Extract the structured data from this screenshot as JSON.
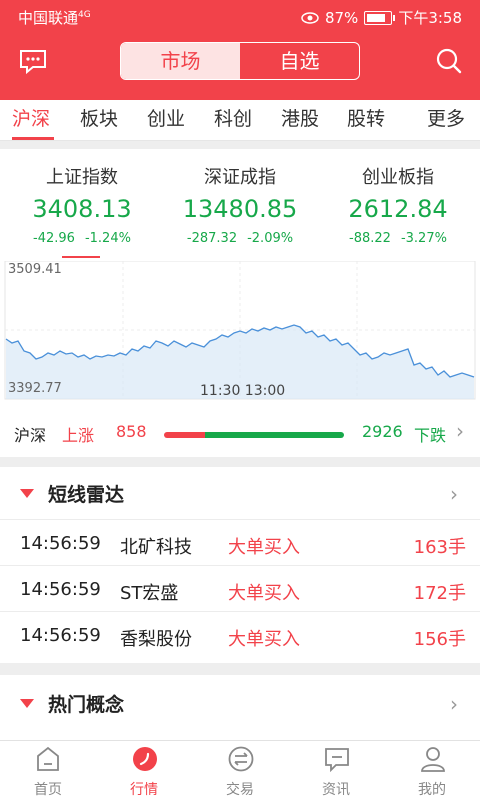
{
  "status": {
    "carrier": "中国联通",
    "network": "4G",
    "battery": "87%",
    "time": "下午3:58"
  },
  "header": {
    "seg_market": "市场",
    "seg_watch": "自选"
  },
  "tabs": [
    "沪深",
    "板块",
    "创业",
    "科创",
    "港股",
    "股转",
    "更多"
  ],
  "indices": [
    {
      "name": "上证指数",
      "value": "3408.13",
      "change": "-42.96",
      "pct": "-1.24%"
    },
    {
      "name": "深证成指",
      "value": "13480.85",
      "change": "-287.32",
      "pct": "-2.09%"
    },
    {
      "name": "创业板指",
      "value": "2612.84",
      "change": "-88.22",
      "pct": "-3.27%"
    }
  ],
  "chart": {
    "high": "3509.41",
    "low": "3392.77",
    "mid": "11:30 13:00",
    "line_color": "#4a90d9"
  },
  "breadth": {
    "market": "沪深",
    "up_label": "上涨",
    "up": "858",
    "down": "2926",
    "down_label": "下跌",
    "up_ratio": 0.227
  },
  "radar": {
    "title": "短线雷达",
    "rows": [
      {
        "time": "14:56:59",
        "name": "北矿科技",
        "signal": "大单买入",
        "vol": "163手"
      },
      {
        "time": "14:56:59",
        "name": "ST宏盛",
        "signal": "大单买入",
        "vol": "172手"
      },
      {
        "time": "14:56:59",
        "name": "香梨股份",
        "signal": "大单买入",
        "vol": "156手"
      }
    ]
  },
  "hot": {
    "title": "热门概念"
  },
  "nav": [
    "首页",
    "行情",
    "交易",
    "资讯",
    "我的"
  ],
  "colors": {
    "brand": "#f2424a",
    "down": "#17a84a"
  }
}
